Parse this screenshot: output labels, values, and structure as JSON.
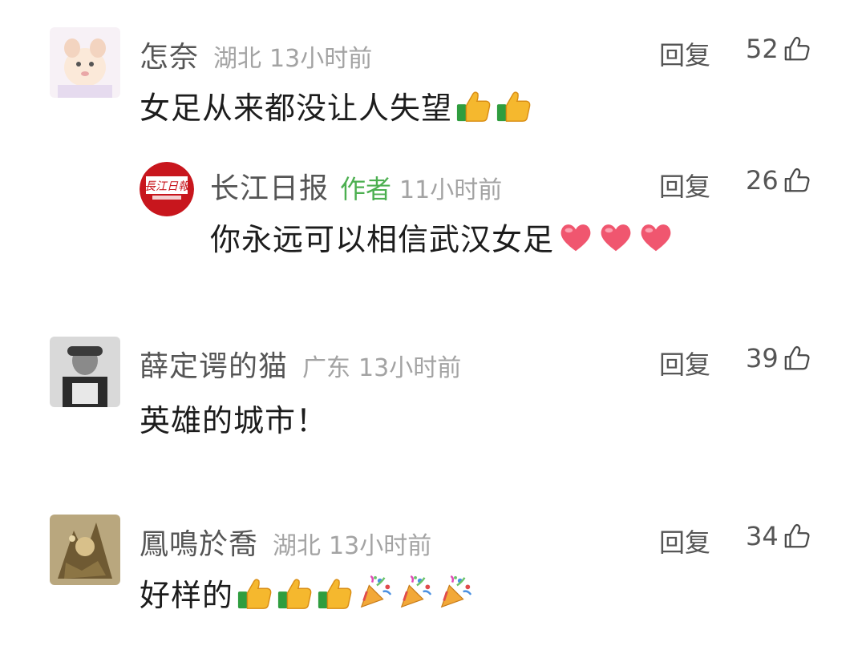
{
  "comments": [
    {
      "username": "怎奈",
      "location": "湖北",
      "time": "13小时前",
      "text": "女足从来都没让人失望",
      "emojis": [
        "thumbs-up-emoji",
        "thumbs-up-emoji"
      ],
      "reply_label": "回复",
      "likes": "52",
      "avatar": "cartoon-avatar"
    },
    {
      "username": "长江日报",
      "author_tag": "作者",
      "time": "11小时前",
      "text": "你永远可以相信武汉女足",
      "emojis": [
        "heart-emoji",
        "heart-emoji",
        "heart-emoji"
      ],
      "reply_label": "回复",
      "likes": "26",
      "avatar": "newspaper-logo-avatar"
    },
    {
      "username": "薛定谔的猫",
      "location": "广东",
      "time": "13小时前",
      "text": "英雄的城市！",
      "emojis": [],
      "reply_label": "回复",
      "likes": "39",
      "avatar": "bw-portrait-avatar"
    },
    {
      "username": "鳳鳴於喬",
      "location": "湖北",
      "time": "13小时前",
      "text": "好样的",
      "emojis": [
        "thumbs-up-emoji",
        "thumbs-up-emoji",
        "thumbs-up-emoji",
        "party-popper-emoji",
        "party-popper-emoji",
        "party-popper-emoji"
      ],
      "reply_label": "回复",
      "likes": "34",
      "avatar": "artwork-avatar"
    }
  ],
  "colors": {
    "author_tag": "#4caf50",
    "meta": "#a3a3a3",
    "username": "#555555",
    "avatar_brand_red": "#c8161d"
  }
}
